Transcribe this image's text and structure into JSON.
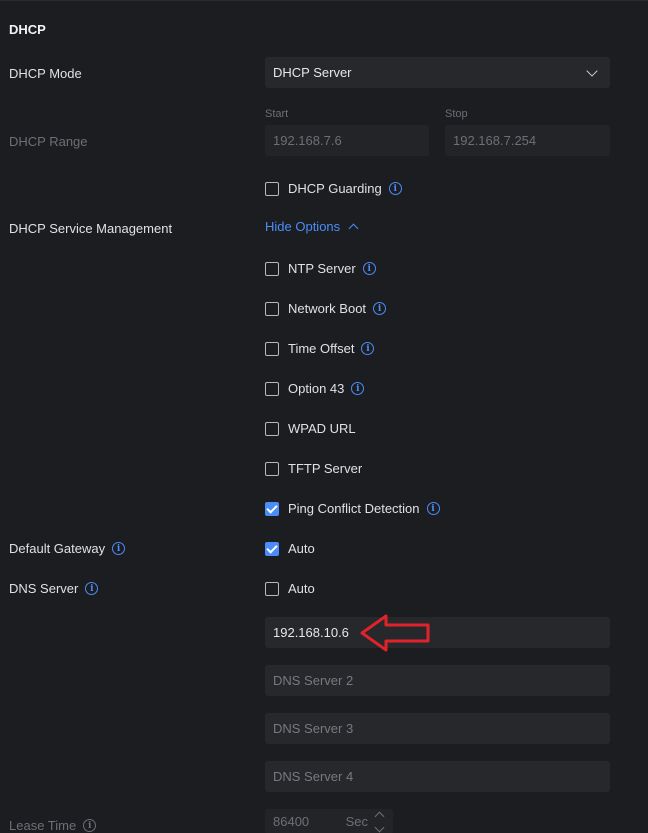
{
  "section": {
    "title": "DHCP"
  },
  "dhcp_mode": {
    "label": "DHCP Mode",
    "value": "DHCP Server"
  },
  "dhcp_range": {
    "label": "DHCP Range",
    "start_label": "Start",
    "start_value": "192.168.7.6",
    "stop_label": "Stop",
    "stop_value": "192.168.7.254"
  },
  "dhcp_guarding": {
    "label": "DHCP Guarding",
    "checked": false
  },
  "service_management": {
    "label": "DHCP Service Management",
    "toggle_label": "Hide Options",
    "options": [
      {
        "label": "NTP Server",
        "checked": false,
        "info": true
      },
      {
        "label": "Network Boot",
        "checked": false,
        "info": true
      },
      {
        "label": "Time Offset",
        "checked": false,
        "info": true
      },
      {
        "label": "Option 43",
        "checked": false,
        "info": true
      },
      {
        "label": "WPAD URL",
        "checked": false,
        "info": false
      },
      {
        "label": "TFTP Server",
        "checked": false,
        "info": false
      },
      {
        "label": "Ping Conflict Detection",
        "checked": true,
        "info": true
      }
    ]
  },
  "default_gateway": {
    "label": "Default Gateway",
    "auto_label": "Auto",
    "auto_checked": true
  },
  "dns_server": {
    "label": "DNS Server",
    "auto_label": "Auto",
    "auto_checked": false,
    "server1_value": "192.168.10.6",
    "server2_placeholder": "DNS Server 2",
    "server3_placeholder": "DNS Server 3",
    "server4_placeholder": "DNS Server 4"
  },
  "lease_time": {
    "label": "Lease Time",
    "value": "86400",
    "unit": "Sec"
  },
  "icons": {
    "info": "info-icon",
    "arrow": "red-arrow-annotation"
  },
  "colors": {
    "accent": "#4b8df8",
    "annotation": "#e0232b",
    "background": "#1c1d20"
  }
}
